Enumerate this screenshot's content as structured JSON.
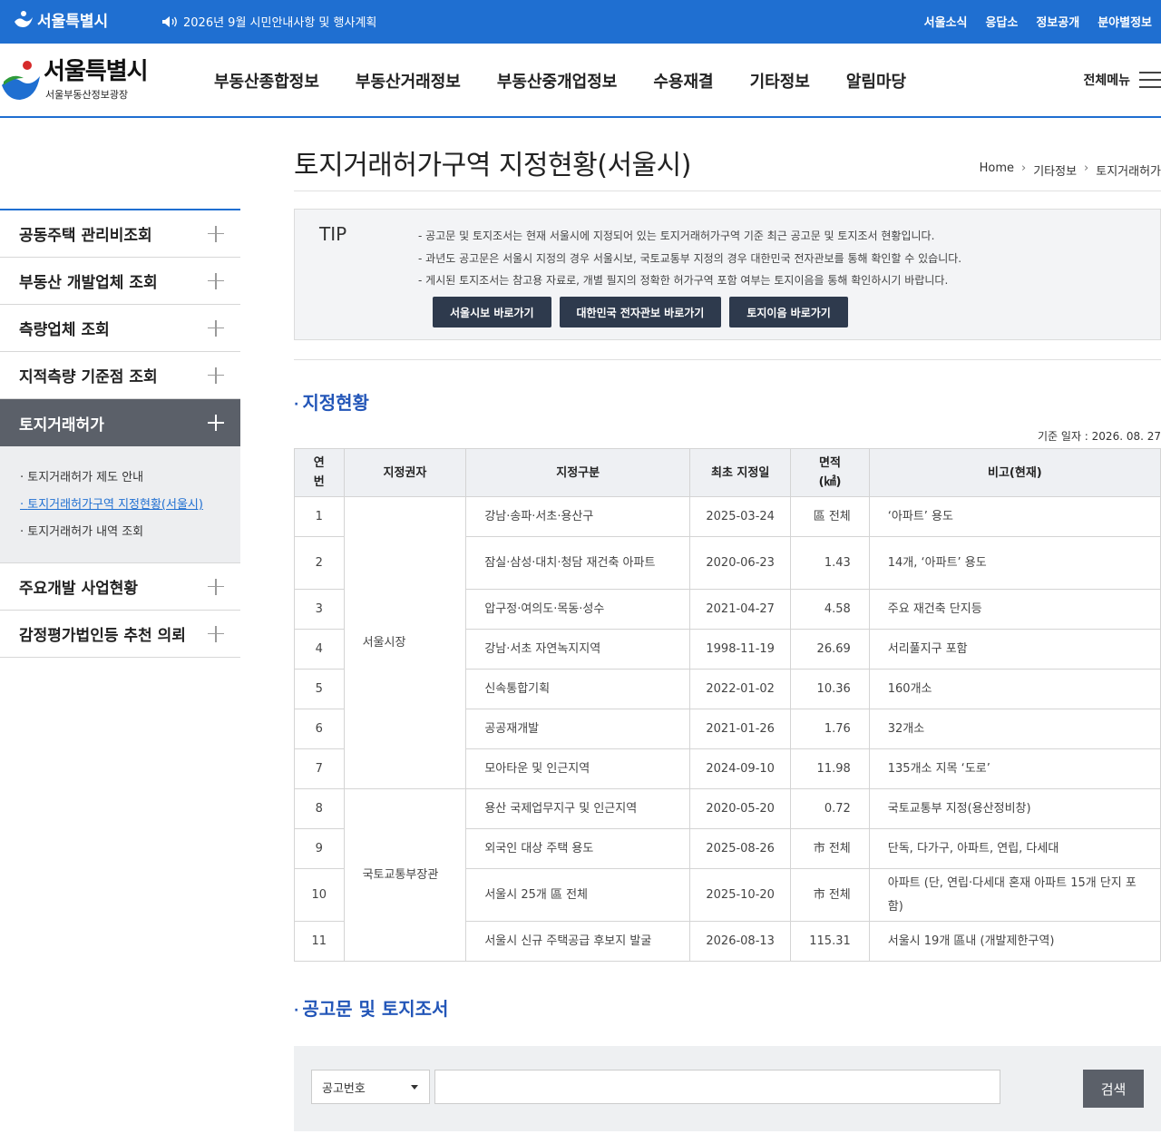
{
  "topbar": {
    "brand": "서울특별시",
    "notice": "2026년 9월 시민안내사항 및 행사계획",
    "links": [
      "서울소식",
      "응답소",
      "정보공개",
      "분야별정보"
    ]
  },
  "header": {
    "logo_title": "서울특별시",
    "logo_sub": "서울부동산정보광장",
    "menu": [
      "부동산종합정보",
      "부동산거래정보",
      "부동산중개업정보",
      "수용재결",
      "기타정보",
      "알림마당"
    ],
    "all_menu": "전체메뉴"
  },
  "lnb": {
    "items_top": [
      "공동주택 관리비조회",
      "부동산 개발업체 조회",
      "측량업체 조회",
      "지적측량 기준점 조회"
    ],
    "active": "토지거래허가",
    "sub": [
      "토지거래허가 제도 안내",
      "토지거래허가구역 지정현황(서울시)",
      "토지거래허가 내역 조회"
    ],
    "items_bottom": [
      "주요개발 사업현황",
      "감정평가법인등 추천 의뢰"
    ]
  },
  "page": {
    "title": "토지거래허가구역 지정현황(서울시)",
    "breadcrumb": [
      "Home",
      "기타정보",
      "토지거래허가"
    ]
  },
  "tip": {
    "label": "TIP",
    "lines": [
      "공고문 및 토지조서는 현재 서울시에 지정되어 있는 토지거래허가구역 기준 최근 공고문 및 토지조서 현황입니다.",
      "과년도 공고문은 서울시 지정의 경우 서울시보, 국토교통부 지정의 경우 대한민국 전자관보를 통해 확인할 수 있습니다.",
      "게시된 토지조서는 참고용 자료로, 개별 필지의 정확한 허가구역 포함 여부는 토지이음을 통해 확인하시기 바랍니다."
    ],
    "buttons": [
      "서울시보 바로가기",
      "대한민국 전자관보 바로가기",
      "토지이음 바로가기"
    ]
  },
  "section1": {
    "title": "지정현황",
    "base_date": "기준 일자 : 2026. 08. 27"
  },
  "table": {
    "headers": [
      "연번",
      "지정권자",
      "지정구분",
      "최초 지정일",
      "면적(㎢)",
      "비고(현재)"
    ],
    "authorities": [
      "서울시장",
      "국토교통부장관"
    ],
    "rows": [
      {
        "no": "1",
        "type": "강남·송파·서초·용산구",
        "date": "2025-03-24",
        "area": "區 전체",
        "note": "‘아파트’ 용도"
      },
      {
        "no": "2",
        "type": "잠실·삼성·대치·청담 재건축 아파트",
        "date": "2020-06-23",
        "area": "1.43",
        "note": "14개, ‘아파트’ 용도"
      },
      {
        "no": "3",
        "type": "압구정·여의도·목동·성수",
        "date": "2021-04-27",
        "area": "4.58",
        "note": "주요 재건축 단지등"
      },
      {
        "no": "4",
        "type": "강남·서초 자연녹지지역",
        "date": "1998-11-19",
        "area": "26.69",
        "note": "서리풀지구 포함"
      },
      {
        "no": "5",
        "type": "신속통합기획",
        "date": "2022-01-02",
        "area": "10.36",
        "note": "160개소"
      },
      {
        "no": "6",
        "type": "공공재개발",
        "date": "2021-01-26",
        "area": "1.76",
        "note": "32개소"
      },
      {
        "no": "7",
        "type": "모아타운 및 인근지역",
        "date": "2024-09-10",
        "area": "11.98",
        "note": "135개소 지목 ‘도로’"
      },
      {
        "no": "8",
        "type": "용산 국제업무지구 및 인근지역",
        "date": "2020-05-20",
        "area": "0.72",
        "note": "국토교통부 지정(용산정비창)"
      },
      {
        "no": "9",
        "type": "외국인 대상 주택 용도",
        "date": "2025-08-26",
        "area": "市 전체",
        "note": "단독, 다가구, 아파트, 연립, 다세대"
      },
      {
        "no": "10",
        "type": "서울시 25개 區 전체",
        "date": "2025-10-20",
        "area": "市 전체",
        "note": "아파트 (단, 연립·다세대 혼재 아파트 15개 단지 포함)"
      },
      {
        "no": "11",
        "type": "서울시 신규 주택공급 후보지 발굴",
        "date": "2026-08-13",
        "area": "115.31",
        "note": "서울시 19개 區내 (개발제한구역)"
      }
    ]
  },
  "section2": {
    "title": "공고문 및 토지조서"
  },
  "search": {
    "select_value": "공고번호",
    "input_value": "",
    "button": "검색"
  }
}
